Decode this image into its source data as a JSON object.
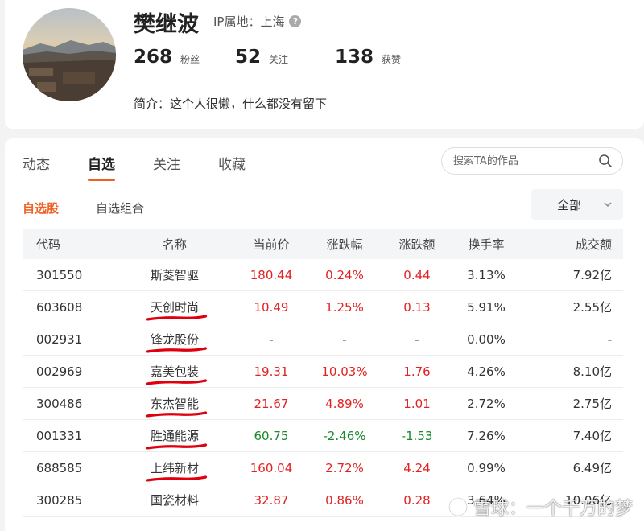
{
  "profile": {
    "name": "樊继波",
    "ip_location": "IP属地：上海",
    "stats": [
      {
        "value": "268",
        "label": "粉丝"
      },
      {
        "value": "52",
        "label": "关注"
      },
      {
        "value": "138",
        "label": "获赞"
      }
    ],
    "bio": "简介：这个人很懒，什么都没有留下"
  },
  "tabs": [
    {
      "label": "动态"
    },
    {
      "label": "自选"
    },
    {
      "label": "关注"
    },
    {
      "label": "收藏"
    }
  ],
  "active_tab": "自选",
  "search": {
    "placeholder": "搜索TA的作品"
  },
  "subtabs": [
    {
      "label": "自选股"
    },
    {
      "label": "自选组合"
    }
  ],
  "filter": {
    "selected": "全部"
  },
  "table": {
    "headers": [
      "代码",
      "名称",
      "当前价",
      "涨跌幅",
      "涨跌额",
      "换手率",
      "成交额"
    ],
    "rows": [
      {
        "code": "301550",
        "name": "斯菱智驱",
        "price": "180.44",
        "pct": "0.24%",
        "chg": "0.44",
        "turnover": "3.13%",
        "volume": "7.92亿",
        "trend": "up",
        "marked": false
      },
      {
        "code": "603608",
        "name": "天创时尚",
        "price": "10.49",
        "pct": "1.25%",
        "chg": "0.13",
        "turnover": "5.91%",
        "volume": "2.55亿",
        "trend": "up",
        "marked": true
      },
      {
        "code": "002931",
        "name": "锋龙股份",
        "price": "-",
        "pct": "-",
        "chg": "-",
        "turnover": "0.00%",
        "volume": "-",
        "trend": "flat",
        "marked": true
      },
      {
        "code": "002969",
        "name": "嘉美包装",
        "price": "19.31",
        "pct": "10.03%",
        "chg": "1.76",
        "turnover": "4.26%",
        "volume": "8.10亿",
        "trend": "up",
        "marked": true
      },
      {
        "code": "300486",
        "name": "东杰智能",
        "price": "21.67",
        "pct": "4.89%",
        "chg": "1.01",
        "turnover": "2.72%",
        "volume": "2.75亿",
        "trend": "up",
        "marked": true
      },
      {
        "code": "001331",
        "name": "胜通能源",
        "price": "60.75",
        "pct": "-2.46%",
        "chg": "-1.53",
        "turnover": "7.26%",
        "volume": "7.40亿",
        "trend": "down",
        "marked": true
      },
      {
        "code": "688585",
        "name": "上纬新材",
        "price": "160.04",
        "pct": "2.72%",
        "chg": "4.24",
        "turnover": "0.99%",
        "volume": "6.49亿",
        "trend": "up",
        "marked": true
      },
      {
        "code": "300285",
        "name": "国瓷材料",
        "price": "32.87",
        "pct": "0.86%",
        "chg": "0.28",
        "turnover": "3.64%",
        "volume": "10.06亿",
        "trend": "up",
        "marked": false
      }
    ]
  },
  "watermark": "雪球：一个千万的梦",
  "colors": {
    "accent": "#f25f22",
    "up": "#e22222",
    "down": "#1a8a2a",
    "marker": "#e0000d"
  }
}
